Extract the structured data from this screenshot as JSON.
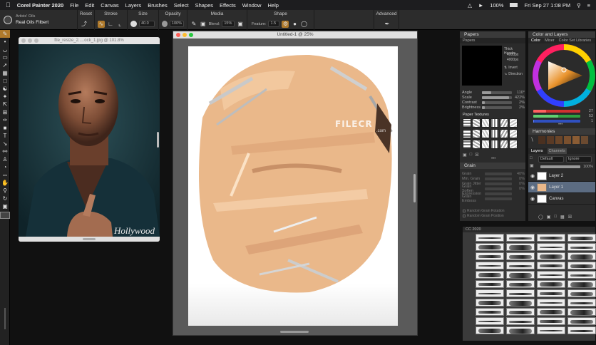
{
  "menubar": {
    "app_name": "Corel Painter 2020",
    "menus": [
      "File",
      "Edit",
      "Canvas",
      "Layers",
      "Brushes",
      "Select",
      "Shapes",
      "Effects",
      "Window",
      "Help"
    ],
    "battery": "100%",
    "datetime": "Fri Sep 27  1:08 PM"
  },
  "propbar": {
    "brush_category": "Artists' Oils",
    "brush_variant": "Real Oils Filbert",
    "reset_label": "Reset",
    "stroke_label": "Stroke",
    "size_label": "Size",
    "size_value": "40.0",
    "opacity_label": "Opacity",
    "opacity_value": "100%",
    "media_label": "Media",
    "blend_label": "Blend:",
    "blend_value": "15%",
    "shape_label": "Shape",
    "feature_label": "Feature:",
    "feature_value": "1.5",
    "advanced_label": "Advanced"
  },
  "reference": {
    "title": "file_resize_2.....ock_1.jpg @ 101.8%",
    "watermark": "Hollywood"
  },
  "document": {
    "title": "Untitled-1 @ 25%"
  },
  "papers_panel": {
    "title": "Papers",
    "tab": "Papers",
    "paper_name": "Thick Handm...",
    "size1": "4000px",
    "size2": "4000px",
    "invert_label": "Invert",
    "direction_label": "Direction",
    "rows": [
      {
        "label": "Angle",
        "value": "110°",
        "level": 0.3
      },
      {
        "label": "Scale",
        "value": "422%",
        "level": 0.9
      },
      {
        "label": "Contrast",
        "value": "2%",
        "level": 0.1
      },
      {
        "label": "Brightness",
        "value": "2%",
        "level": 0.1
      }
    ],
    "textures_title": "Paper Textures"
  },
  "grain_panel": {
    "title": "Grain",
    "rows": [
      {
        "label": "Grain",
        "value": "40%"
      },
      {
        "label": "Min. Grain",
        "value": "0%"
      },
      {
        "label": "Grain Jitter",
        "value": "0%"
      },
      {
        "label": "Grain Soften",
        "value": "0%"
      },
      {
        "label": "Expression",
        "value": ""
      },
      {
        "label": "Grain Emboss",
        "value": ""
      }
    ],
    "random_grain_rotation": "Random Grain Rotation",
    "random_grain_position": "Random Grain Position"
  },
  "color_panel": {
    "title": "Color and Layers",
    "tabs": [
      "Color",
      "Mixer",
      "Color Set Libraries"
    ],
    "values": [
      "27",
      "53",
      "1"
    ],
    "harmonies_title": "Harmonies"
  },
  "layers_panel": {
    "title": "Layers",
    "tab2": "Channels",
    "composite_method": "Default",
    "composite_mode": "Ignore",
    "opacity": "100%",
    "layers": [
      {
        "name": "Layer 2",
        "selected": false
      },
      {
        "name": "Layer 1",
        "selected": true
      },
      {
        "name": "Canvas",
        "selected": false
      }
    ]
  },
  "brushes_panel": {
    "title": "CC 2020"
  },
  "watermark": {
    "text": "FILECR",
    "sub": ".com"
  },
  "colors": {
    "skin": "#eab88a",
    "accent": "#b07a2b",
    "layer_selected": "#5c6c82"
  }
}
